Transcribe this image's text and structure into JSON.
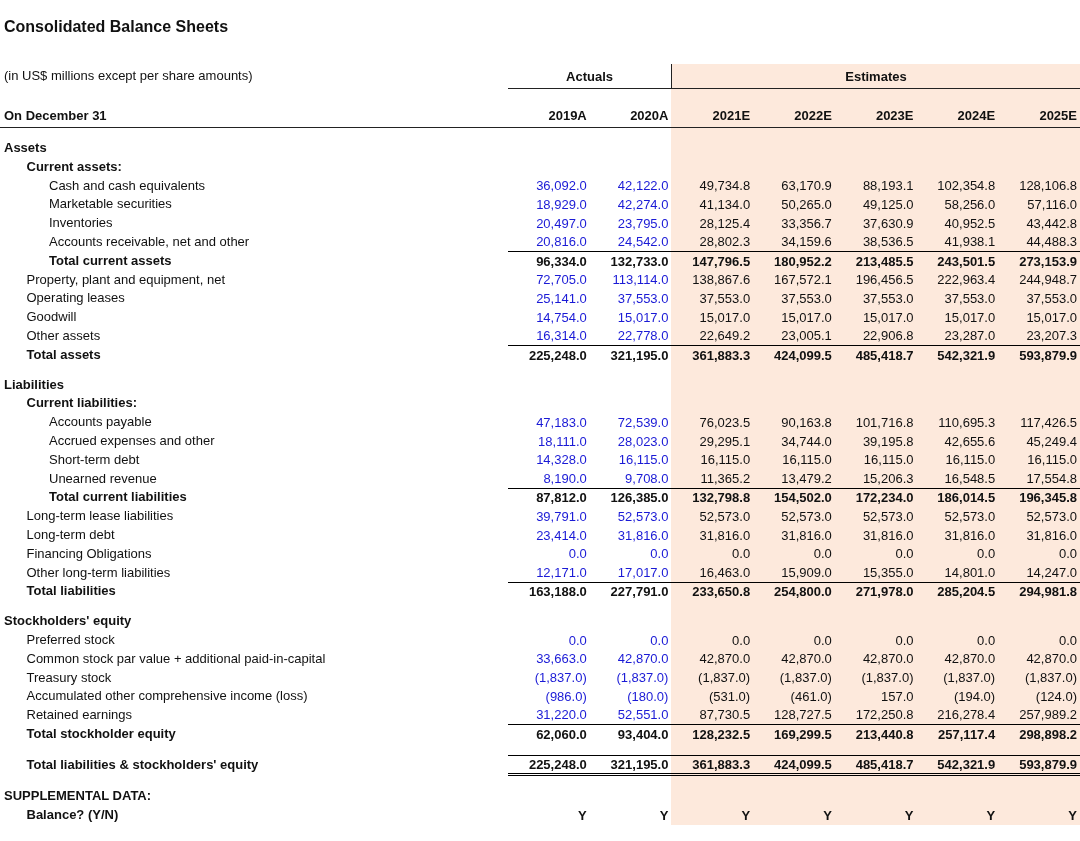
{
  "title": "Consolidated Balance Sheets",
  "units": "(in US$ millions except per share amounts)",
  "column_groups": [
    {
      "label": "Actuals",
      "estimate": false
    },
    {
      "label": "Estimates",
      "estimate": true
    }
  ],
  "date_label": "On December 31",
  "columns": [
    {
      "label": "2019A",
      "estimate": false
    },
    {
      "label": "2020A",
      "estimate": false
    },
    {
      "label": "2021E",
      "estimate": true
    },
    {
      "label": "2022E",
      "estimate": true
    },
    {
      "label": "2023E",
      "estimate": true
    },
    {
      "label": "2024E",
      "estimate": true
    },
    {
      "label": "2025E",
      "estimate": true
    }
  ],
  "sections": [
    {
      "title": "Assets",
      "rows": [
        {
          "kind": "group",
          "label": "Current assets:",
          "children": [
            {
              "kind": "line",
              "label": "Cash and cash equivalents",
              "values": [
                "36,092.0",
                "42,122.0",
                "49,734.8",
                "63,170.9",
                "88,193.1",
                "102,354.8",
                "128,106.8"
              ]
            },
            {
              "kind": "line",
              "label": "Marketable securities",
              "values": [
                "18,929.0",
                "42,274.0",
                "41,134.0",
                "50,265.0",
                "49,125.0",
                "58,256.0",
                "57,116.0"
              ]
            },
            {
              "kind": "line",
              "label": "Inventories",
              "values": [
                "20,497.0",
                "23,795.0",
                "28,125.4",
                "33,356.7",
                "37,630.9",
                "40,952.5",
                "43,442.8"
              ]
            },
            {
              "kind": "line",
              "label": "Accounts receivable, net and other",
              "values": [
                "20,816.0",
                "24,542.0",
                "28,802.3",
                "34,159.6",
                "38,536.5",
                "41,938.1",
                "44,488.3"
              ]
            },
            {
              "kind": "total",
              "label": "Total current assets",
              "values": [
                "96,334.0",
                "132,733.0",
                "147,796.5",
                "180,952.2",
                "213,485.5",
                "243,501.5",
                "273,153.9"
              ]
            }
          ]
        },
        {
          "kind": "line",
          "label": "Property, plant and equipment, net",
          "values": [
            "72,705.0",
            "113,114.0",
            "138,867.6",
            "167,572.1",
            "196,456.5",
            "222,963.4",
            "244,948.7"
          ]
        },
        {
          "kind": "line",
          "label": "Operating leases",
          "values": [
            "25,141.0",
            "37,553.0",
            "37,553.0",
            "37,553.0",
            "37,553.0",
            "37,553.0",
            "37,553.0"
          ]
        },
        {
          "kind": "line",
          "label": "Goodwill",
          "values": [
            "14,754.0",
            "15,017.0",
            "15,017.0",
            "15,017.0",
            "15,017.0",
            "15,017.0",
            "15,017.0"
          ]
        },
        {
          "kind": "line",
          "label": "Other assets",
          "values": [
            "16,314.0",
            "22,778.0",
            "22,649.2",
            "23,005.1",
            "22,906.8",
            "23,287.0",
            "23,207.3"
          ]
        },
        {
          "kind": "total",
          "label": "Total assets",
          "values": [
            "225,248.0",
            "321,195.0",
            "361,883.3",
            "424,099.5",
            "485,418.7",
            "542,321.9",
            "593,879.9"
          ]
        }
      ]
    },
    {
      "title": "Liabilities",
      "rows": [
        {
          "kind": "group",
          "label": "Current liabilities:",
          "children": [
            {
              "kind": "line",
              "label": "Accounts payable",
              "values": [
                "47,183.0",
                "72,539.0",
                "76,023.5",
                "90,163.8",
                "101,716.8",
                "110,695.3",
                "117,426.5"
              ]
            },
            {
              "kind": "line",
              "label": "Accrued expenses and other",
              "values": [
                "18,111.0",
                "28,023.0",
                "29,295.1",
                "34,744.0",
                "39,195.8",
                "42,655.6",
                "45,249.4"
              ]
            },
            {
              "kind": "line",
              "label": "Short-term debt",
              "values": [
                "14,328.0",
                "16,115.0",
                "16,115.0",
                "16,115.0",
                "16,115.0",
                "16,115.0",
                "16,115.0"
              ]
            },
            {
              "kind": "line",
              "label": "Unearned revenue",
              "values": [
                "8,190.0",
                "9,708.0",
                "11,365.2",
                "13,479.2",
                "15,206.3",
                "16,548.5",
                "17,554.8"
              ]
            },
            {
              "kind": "total",
              "label": "Total current liabilities",
              "values": [
                "87,812.0",
                "126,385.0",
                "132,798.8",
                "154,502.0",
                "172,234.0",
                "186,014.5",
                "196,345.8"
              ]
            }
          ]
        },
        {
          "kind": "line",
          "label": "Long-term lease liabilities",
          "values": [
            "39,791.0",
            "52,573.0",
            "52,573.0",
            "52,573.0",
            "52,573.0",
            "52,573.0",
            "52,573.0"
          ]
        },
        {
          "kind": "line",
          "label": "Long-term debt",
          "values": [
            "23,414.0",
            "31,816.0",
            "31,816.0",
            "31,816.0",
            "31,816.0",
            "31,816.0",
            "31,816.0"
          ]
        },
        {
          "kind": "line",
          "label": "Financing Obligations",
          "values": [
            "0.0",
            "0.0",
            "0.0",
            "0.0",
            "0.0",
            "0.0",
            "0.0"
          ]
        },
        {
          "kind": "line",
          "label": "Other long-term liabilities",
          "values": [
            "12,171.0",
            "17,017.0",
            "16,463.0",
            "15,909.0",
            "15,355.0",
            "14,801.0",
            "14,247.0"
          ]
        },
        {
          "kind": "total",
          "label": "Total liabilities",
          "values": [
            "163,188.0",
            "227,791.0",
            "233,650.8",
            "254,800.0",
            "271,978.0",
            "285,204.5",
            "294,981.8"
          ]
        }
      ]
    },
    {
      "title": "Stockholders' equity",
      "rows": [
        {
          "kind": "line",
          "label": "Preferred stock",
          "values": [
            "0.0",
            "0.0",
            "0.0",
            "0.0",
            "0.0",
            "0.0",
            "0.0"
          ]
        },
        {
          "kind": "line",
          "label": "Common stock par value + additional paid-in-capital",
          "values": [
            "33,663.0",
            "42,870.0",
            "42,870.0",
            "42,870.0",
            "42,870.0",
            "42,870.0",
            "42,870.0"
          ]
        },
        {
          "kind": "line",
          "label": "Treasury stock",
          "values": [
            "(1,837.0)",
            "(1,837.0)",
            "(1,837.0)",
            "(1,837.0)",
            "(1,837.0)",
            "(1,837.0)",
            "(1,837.0)"
          ]
        },
        {
          "kind": "line",
          "label": "Accumulated other comprehensive income (loss)",
          "values": [
            "(986.0)",
            "(180.0)",
            "(531.0)",
            "(461.0)",
            "157.0",
            "(194.0)",
            "(124.0)"
          ]
        },
        {
          "kind": "line",
          "label": "Retained earnings",
          "values": [
            "31,220.0",
            "52,551.0",
            "87,730.5",
            "128,727.5",
            "172,250.8",
            "216,278.4",
            "257,989.2"
          ]
        },
        {
          "kind": "total",
          "label": "Total stockholder equity",
          "values": [
            "62,060.0",
            "93,404.0",
            "128,232.5",
            "169,299.5",
            "213,440.8",
            "257,117.4",
            "298,898.2"
          ]
        }
      ]
    },
    {
      "rows": [
        {
          "kind": "grand_total",
          "label": "Total liabilities & stockholders' equity",
          "values": [
            "225,248.0",
            "321,195.0",
            "361,883.3",
            "424,099.5",
            "485,418.7",
            "542,321.9",
            "593,879.9"
          ]
        }
      ]
    },
    {
      "title": "SUPPLEMENTAL DATA:",
      "rows": [
        {
          "kind": "check",
          "label": "Balance? (Y/N)",
          "values": [
            "Y",
            "Y",
            "Y",
            "Y",
            "Y",
            "Y",
            "Y"
          ]
        }
      ]
    }
  ]
}
